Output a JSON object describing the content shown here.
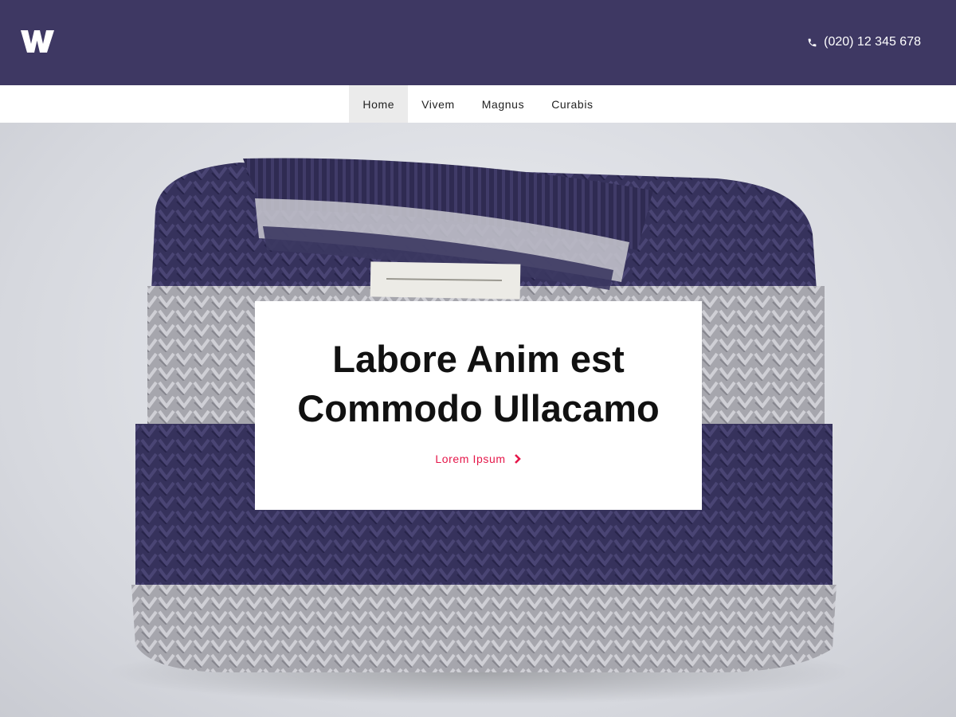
{
  "header": {
    "logo_icon": "w-logo-icon",
    "phone_icon": "phone-icon",
    "phone_number": "(020) 12 345 678",
    "background_color": "#3e3863"
  },
  "nav": {
    "items": [
      {
        "label": "Home",
        "active": true
      },
      {
        "label": "Vivem",
        "active": false
      },
      {
        "label": "Magnus",
        "active": false
      },
      {
        "label": "Curabis",
        "active": false
      }
    ]
  },
  "hero": {
    "image_subject": "folded striped knit sweater",
    "card": {
      "title_line1": "Labore Anim est",
      "title_line2": "Commodo Ullacamo",
      "link_label": "Lorem Ipsum",
      "link_icon": "chevron-right-icon",
      "link_color": "#e5174a"
    }
  }
}
